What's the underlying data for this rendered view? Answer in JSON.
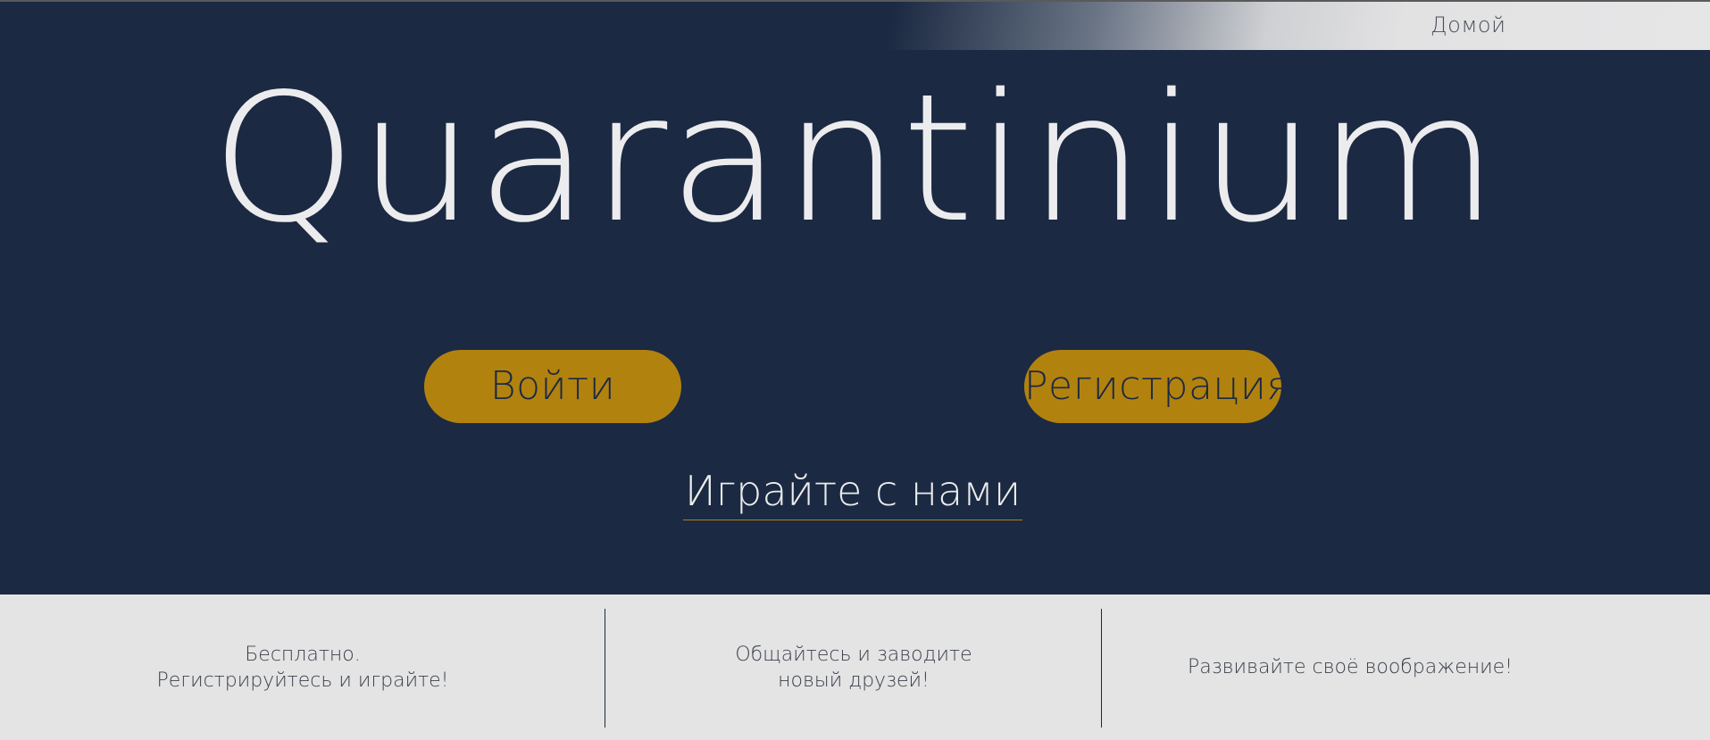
{
  "nav": {
    "home_label": "Домой"
  },
  "hero": {
    "title": "Quarantinium",
    "login_label": "Войти",
    "register_label": "Регистрация",
    "play_label": "Играйте с нами"
  },
  "features": [
    {
      "line1": "Бесплатно.",
      "line2": "Регистрируйтесь и играйте!"
    },
    {
      "line1": "Общайтесь и заводите",
      "line2": "новый друзей!"
    },
    {
      "line1": "Развивайте своё воображение!",
      "line2": ""
    }
  ],
  "colors": {
    "background": "#1b2942",
    "accent": "#b2820f",
    "footer_bg": "#e4e4e4",
    "title_text": "#ececee"
  }
}
